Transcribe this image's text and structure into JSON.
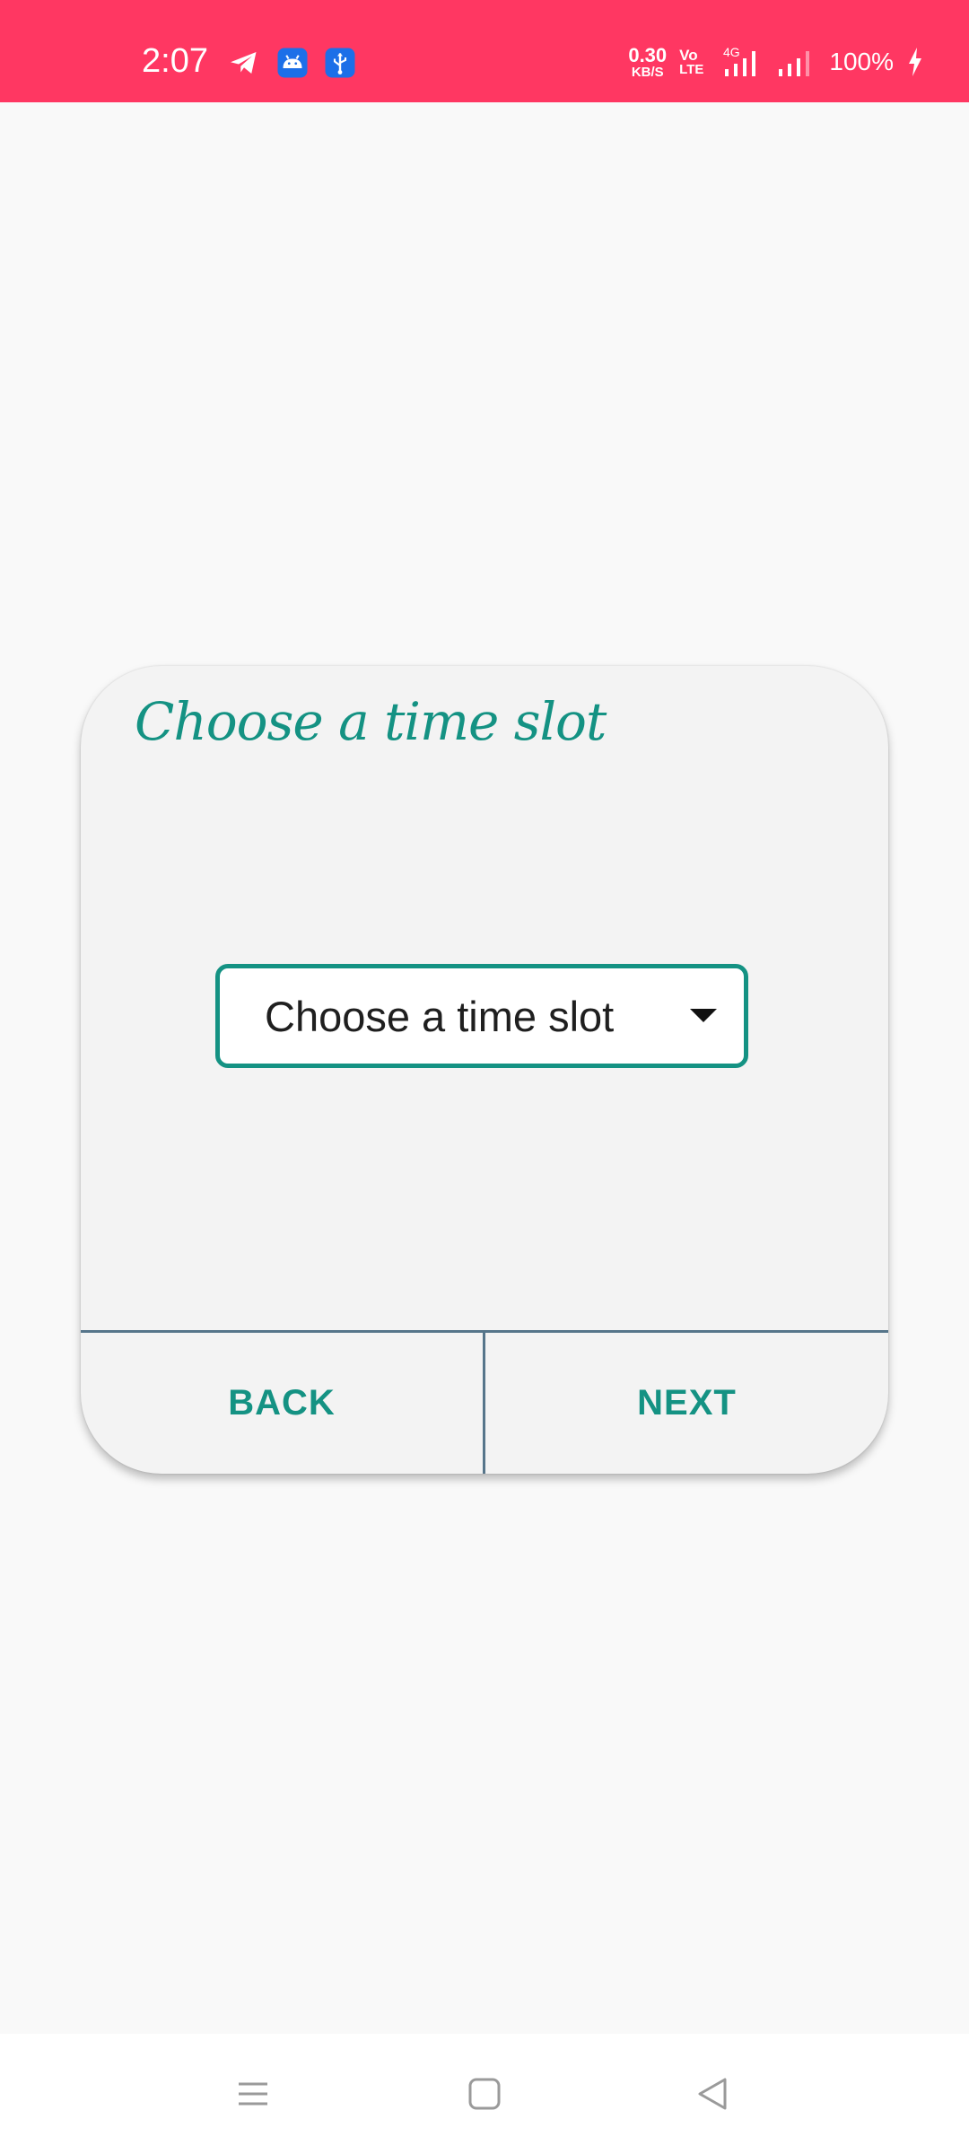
{
  "status_bar": {
    "time": "2:07",
    "net_speed_value": "0.30",
    "net_speed_unit": "KB/S",
    "volte_top": "Vo",
    "volte_bottom": "LTE",
    "network_type": "4G",
    "battery": "100%",
    "icons": [
      "telegram-icon",
      "android-icon",
      "usb-icon",
      "signal-icon",
      "battery-charging-icon"
    ]
  },
  "dialog": {
    "title": "Choose a time slot",
    "dropdown": {
      "selected": "Choose a time slot"
    },
    "back_label": "BACK",
    "next_label": "NEXT"
  },
  "nav_bar": {
    "icons": [
      "menu-icon",
      "home-icon",
      "back-icon"
    ]
  },
  "colors": {
    "status_bar": "#ff3762",
    "accent": "#149283",
    "divider": "#56758a",
    "card_background": "#f3f3f3",
    "page_background": "#f9f9f9"
  }
}
